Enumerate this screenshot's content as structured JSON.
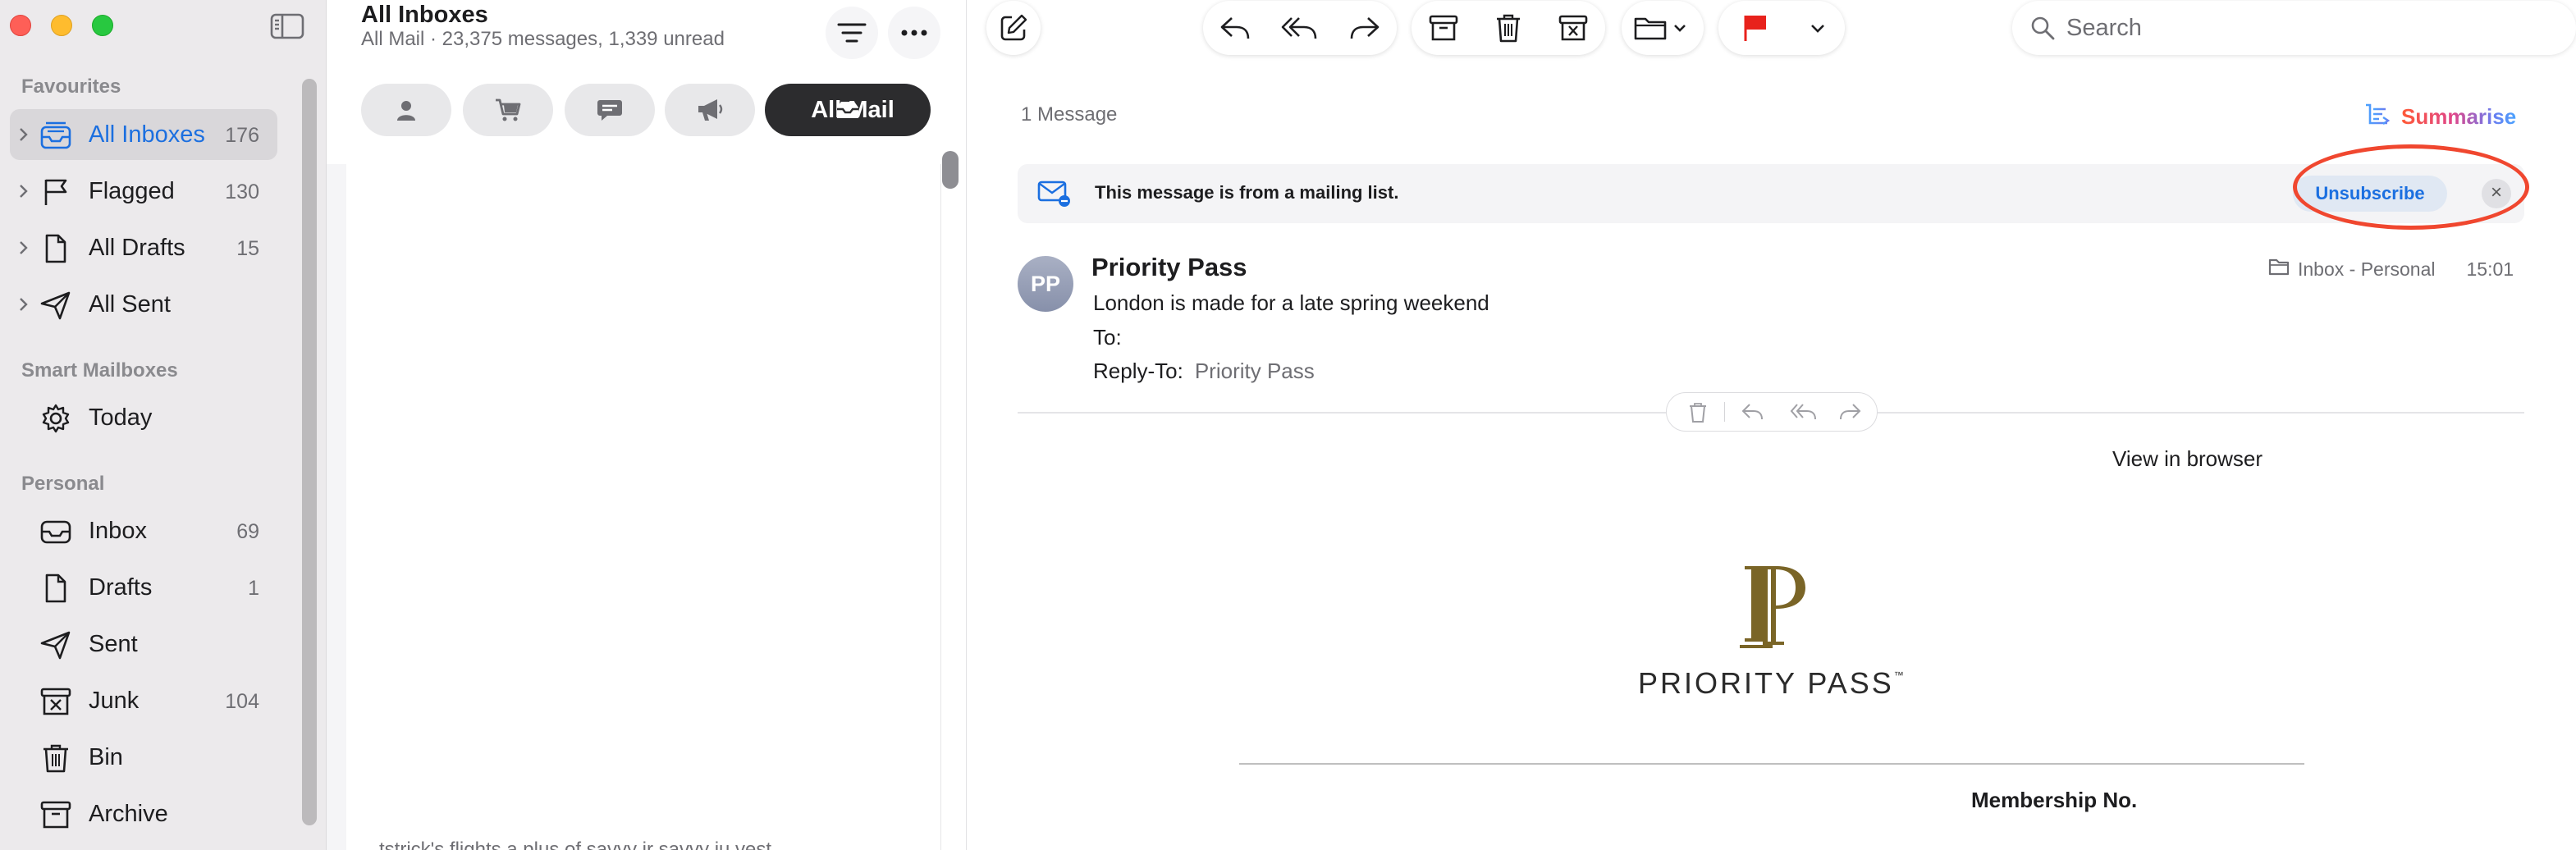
{
  "window": {
    "controls": [
      "close",
      "minimize",
      "zoom"
    ]
  },
  "sidebar": {
    "sections": [
      {
        "title": "Favourites",
        "items": [
          {
            "label": "All Inboxes",
            "count": "176",
            "icon": "inbox-stack-icon",
            "selected": true,
            "expandable": true
          },
          {
            "label": "Flagged",
            "count": "130",
            "icon": "flag-icon",
            "expandable": true
          },
          {
            "label": "All Drafts",
            "count": "15",
            "icon": "document-icon",
            "expandable": true
          },
          {
            "label": "All Sent",
            "count": "",
            "icon": "paper-plane-icon",
            "expandable": true
          }
        ]
      },
      {
        "title": "Smart Mailboxes",
        "items": [
          {
            "label": "Today",
            "count": "",
            "icon": "gear-icon"
          }
        ]
      },
      {
        "title": "Personal",
        "items": [
          {
            "label": "Inbox",
            "count": "69",
            "icon": "inbox-tray-icon"
          },
          {
            "label": "Drafts",
            "count": "1",
            "icon": "document-icon"
          },
          {
            "label": "Sent",
            "count": "",
            "icon": "paper-plane-icon"
          },
          {
            "label": "Junk",
            "count": "104",
            "icon": "junk-box-icon"
          },
          {
            "label": "Bin",
            "count": "",
            "icon": "trash-icon"
          },
          {
            "label": "Archive",
            "count": "",
            "icon": "archive-box-icon"
          }
        ]
      }
    ]
  },
  "message_list": {
    "title": "All Inboxes",
    "subtitle": "All Mail · 23,375 messages, 1,339 unread",
    "filters": [
      {
        "icon": "person-icon",
        "label": ""
      },
      {
        "icon": "cart-icon",
        "label": ""
      },
      {
        "icon": "chat-bubble-icon",
        "label": ""
      },
      {
        "icon": "megaphone-icon",
        "label": ""
      },
      {
        "icon": "tray-icon",
        "label": "All Mail",
        "selected": true
      }
    ],
    "partial_preview": "…tstrick's flights  a plus of savvy jr savvy ju  vest"
  },
  "toolbar": {
    "compose_icon": "compose-icon",
    "actions": [
      "reply-icon",
      "reply-all-icon",
      "forward-icon",
      "archive-icon",
      "trash-icon",
      "junk-icon",
      "move-to-folder-icon",
      "flag-icon",
      "chevron-down-icon"
    ],
    "flag_color": "#e8221c",
    "search_placeholder": "Search"
  },
  "reader": {
    "message_count": "1 Message",
    "summarise_label": "Summarise",
    "banner": {
      "text": "This message is from a mailing list.",
      "unsubscribe_label": "Unsubscribe",
      "close_glyph": "×",
      "highlight_color": "#f0472f"
    },
    "header": {
      "avatar_initials": "PP",
      "sender": "Priority Pass",
      "subject": "London is made for a late spring weekend",
      "to_label": "To:",
      "reply_to_label": "Reply-To:",
      "reply_to_value": "Priority Pass",
      "mailbox": "Inbox - Personal",
      "time": "15:01"
    },
    "body": {
      "view_in_browser": "View in browser",
      "logo_text": "PRIORITY PASS",
      "logo_tm": "™",
      "logo_color": "#7a6527",
      "membership_label": "Membership No."
    }
  }
}
